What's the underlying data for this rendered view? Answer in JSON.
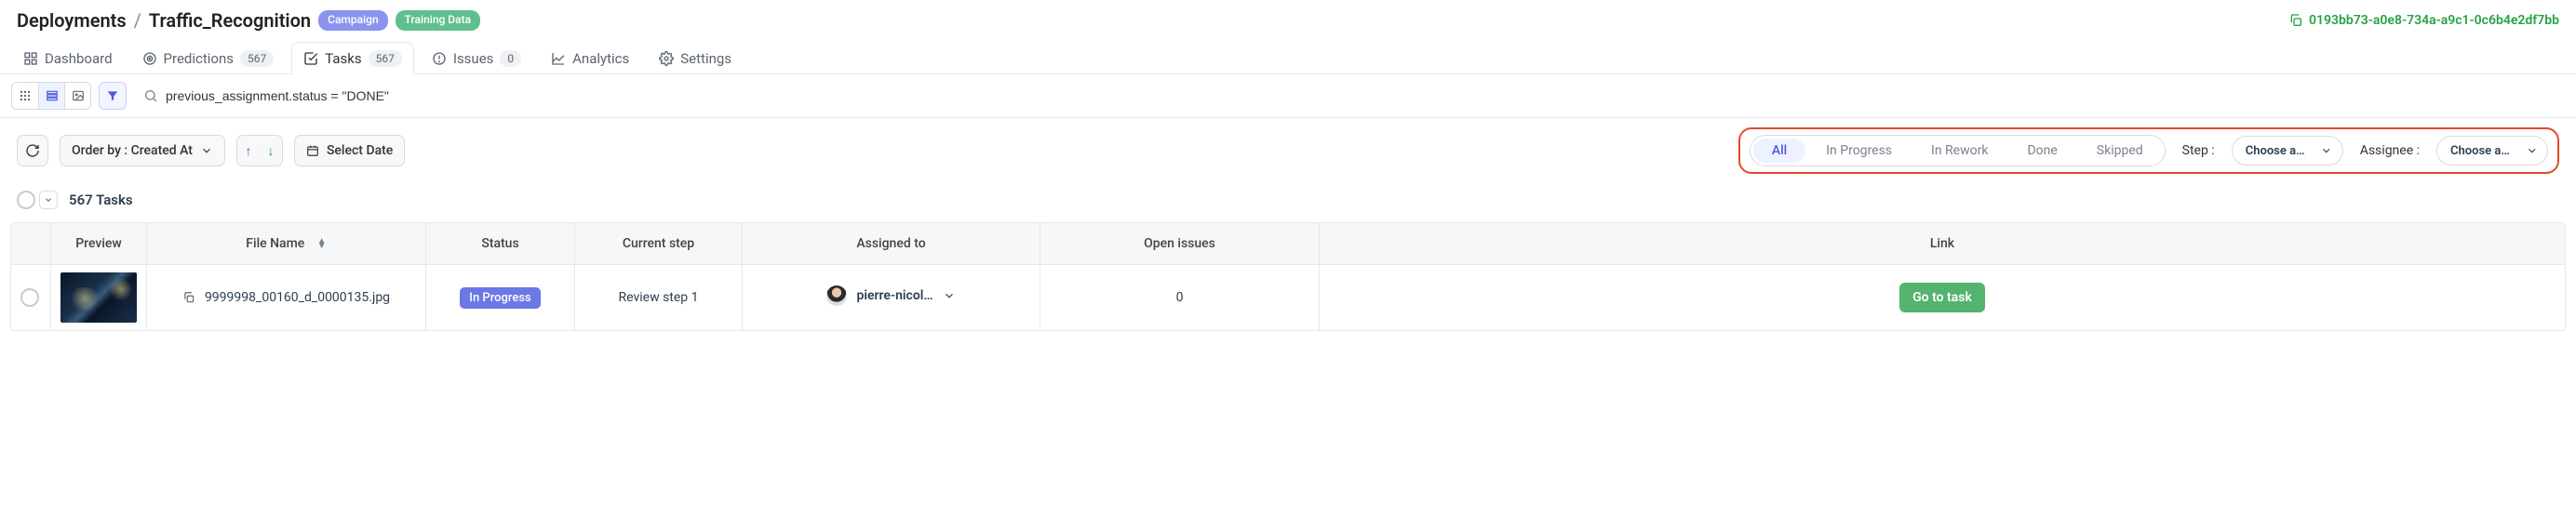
{
  "breadcrumb": {
    "root": "Deployments",
    "sep": "/",
    "current": "Traffic_Recognition"
  },
  "badges": {
    "campaign": "Campaign",
    "training": "Training Data"
  },
  "deployment_id": "0193bb73-a0e8-734a-a9c1-0c6b4e2df7bb",
  "tabs": {
    "dashboard": "Dashboard",
    "predictions": "Predictions",
    "predictions_count": "567",
    "tasks": "Tasks",
    "tasks_count": "567",
    "issues": "Issues",
    "issues_count": "0",
    "analytics": "Analytics",
    "settings": "Settings"
  },
  "search": {
    "value": "previous_assignment.status = \"DONE\""
  },
  "controls": {
    "order_by": "Order by : Created At",
    "select_date": "Select Date",
    "step_label": "Step :",
    "step_value": "Choose an …",
    "assignee_label": "Assignee :",
    "assignee_value": "Choose an …"
  },
  "segmented": {
    "all": "All",
    "in_progress": "In Progress",
    "in_rework": "In Rework",
    "done": "Done",
    "skipped": "Skipped"
  },
  "count": "567 Tasks",
  "table": {
    "headers": {
      "preview": "Preview",
      "filename": "File Name",
      "status": "Status",
      "current_step": "Current step",
      "assigned_to": "Assigned to",
      "open_issues": "Open issues",
      "link": "Link"
    },
    "rows": [
      {
        "filename": "9999998_00160_d_0000135.jpg",
        "status": "In Progress",
        "current_step": "Review step 1",
        "assignee": "pierre-nicol…",
        "open_issues": "0",
        "link_label": "Go to task"
      }
    ]
  }
}
